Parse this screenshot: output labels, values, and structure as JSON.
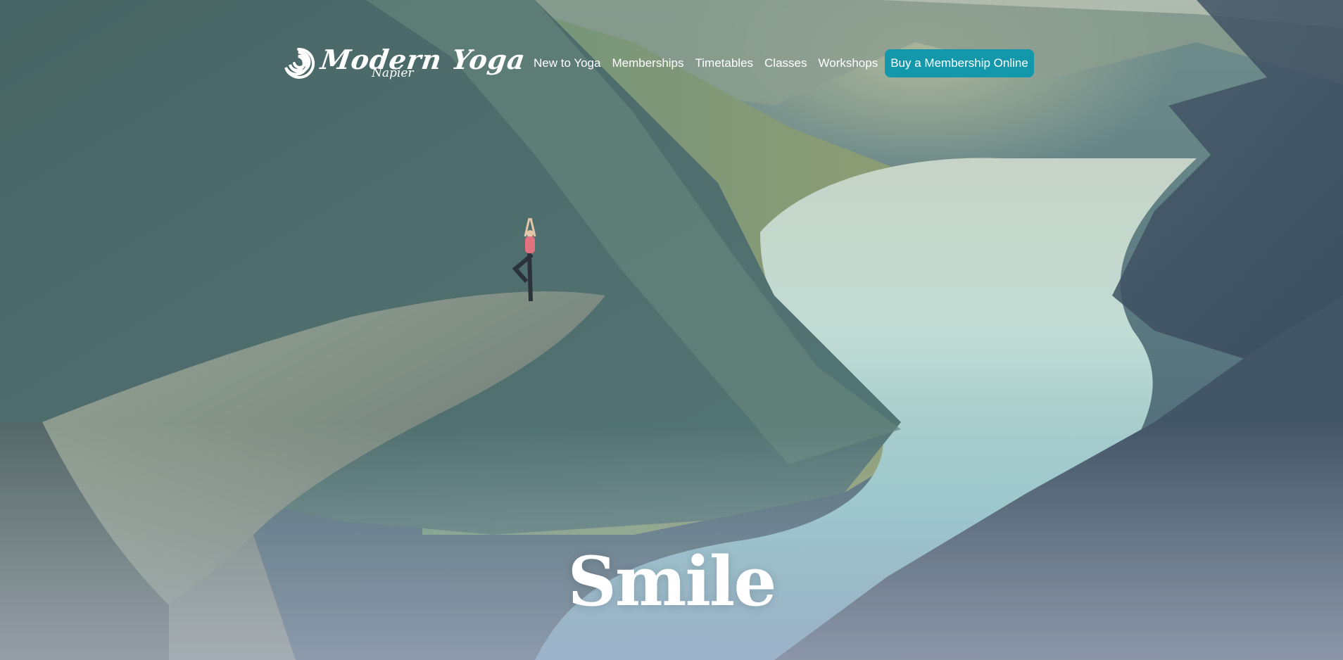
{
  "logo": {
    "word": "Modern Yoga",
    "sub": "Napier"
  },
  "nav": {
    "items": [
      {
        "label": "New to Yoga"
      },
      {
        "label": "Memberships"
      },
      {
        "label": "Timetables"
      },
      {
        "label": "Classes"
      },
      {
        "label": "Workshops"
      }
    ],
    "cta": {
      "label": "Buy a Membership Online"
    }
  },
  "hero": {
    "headline": "Smile"
  },
  "colors": {
    "cta_background": "#1398ab",
    "text": "#ffffff"
  },
  "icons": {
    "logo": "swirl-logo-icon"
  }
}
